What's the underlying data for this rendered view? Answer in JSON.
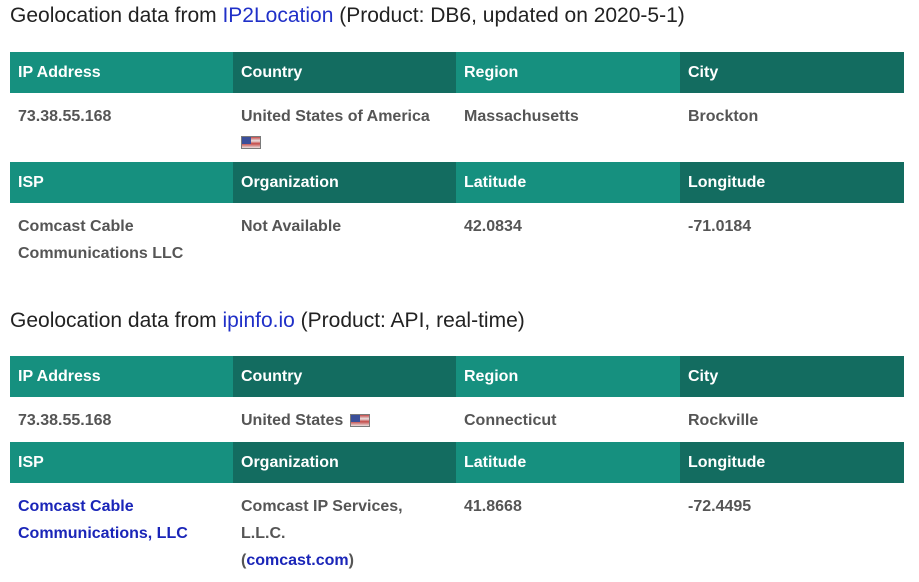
{
  "sections": [
    {
      "title_prefix": "Geolocation data from ",
      "source_link": "IP2Location",
      "title_suffix": " (Product: DB6, updated on 2020-5-1)",
      "headers1": [
        "IP Address",
        "Country",
        "Region",
        "City"
      ],
      "row1": {
        "ip": "73.38.55.168",
        "country": "United States of America",
        "region": "Massachusetts",
        "city": "Brockton"
      },
      "headers2": [
        "ISP",
        "Organization",
        "Latitude",
        "Longitude"
      ],
      "row2": {
        "isp": "Comcast Cable Communications LLC",
        "organization": "Not Available",
        "latitude": "42.0834",
        "longitude": "-71.0184"
      }
    },
    {
      "title_prefix": "Geolocation data from ",
      "source_link": "ipinfo.io",
      "title_suffix": " (Product: API, real-time)",
      "headers1": [
        "IP Address",
        "Country",
        "Region",
        "City"
      ],
      "row1": {
        "ip": "73.38.55.168",
        "country": "United States",
        "region": "Connecticut",
        "city": "Rockville"
      },
      "headers2": [
        "ISP",
        "Organization",
        "Latitude",
        "Longitude"
      ],
      "row2": {
        "isp": "Comcast Cable Communications, LLC",
        "organization_prefix": "Comcast IP Services, L.L.C.",
        "organization_link": "comcast.com",
        "latitude": "41.8668",
        "longitude": "-72.4495"
      }
    }
  ],
  "icons": {
    "flag": "us-flag-icon"
  },
  "colors": {
    "header_light": "#16907f",
    "header_dark": "#136c60",
    "link": "#2030c8"
  }
}
